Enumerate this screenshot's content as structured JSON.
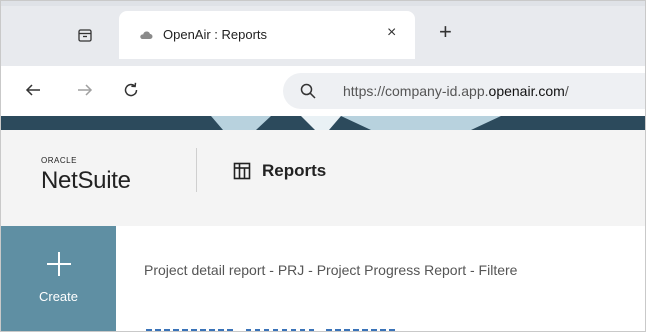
{
  "browser": {
    "tab": {
      "title": "OpenAir : Reports",
      "close_icon": "×",
      "favicon": "cloud-icon"
    },
    "new_tab_icon": "+",
    "address": {
      "prefix": "https://company-id.app.",
      "domain": "openair.com",
      "suffix": "/"
    }
  },
  "app": {
    "logo": {
      "top": "ORACLE",
      "main": "NetSuite"
    },
    "section_title": "Reports",
    "sidebar": {
      "create_label": "Create",
      "create_icon": "+"
    },
    "report_title": "Project detail report - PRJ - Project Progress Report - Filtere"
  },
  "colors": {
    "sidebar": "#5f8fa3",
    "banner_dark": "#2c4a5c",
    "banner_light": "#b8d2de"
  }
}
